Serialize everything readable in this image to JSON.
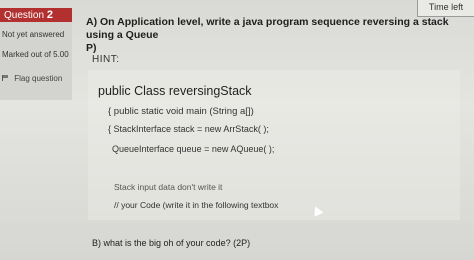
{
  "timer": {
    "label": "Time left"
  },
  "question_info": {
    "question_prefix": "Question",
    "question_number": "2",
    "status": "Not yet answered",
    "marks": "Marked out of 5.00",
    "flag_label": "Flag question"
  },
  "question": {
    "line1": "A) On Application level, write a java program sequence reversing a stack using a Queue",
    "line2": "P)",
    "hint_label": "HINT:",
    "code": {
      "class_decl": "public Class reversingStack",
      "main_decl": "{ public static void main (String a[])",
      "stack_decl": "{   StackInterface stack = new ArrStack( );",
      "queue_decl": "QueueInterface  queue = new AQueue( );",
      "stack_input": "Stack input data don't write it",
      "your_code": "// your Code (write it in the following  textbox"
    },
    "part_b": "B) what is the big oh of your code? (2P)"
  }
}
